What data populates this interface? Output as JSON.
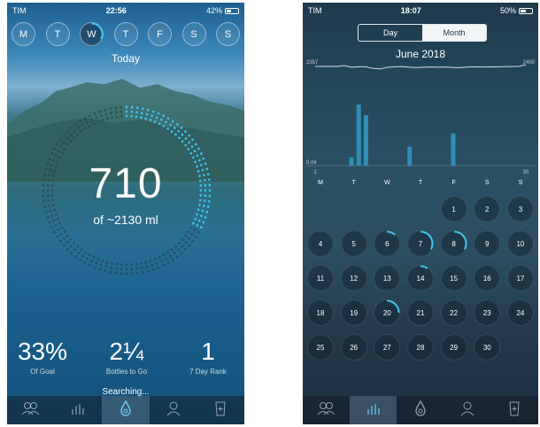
{
  "left": {
    "status": {
      "carrier": "TIM",
      "time": "22:56",
      "battery": "42%",
      "battery_level": 0.42
    },
    "weekdays": [
      {
        "label": "M",
        "active": false
      },
      {
        "label": "T",
        "active": false
      },
      {
        "label": "W",
        "active": true,
        "progress": 0.33
      },
      {
        "label": "T",
        "active": false
      },
      {
        "label": "F",
        "active": false
      },
      {
        "label": "S",
        "active": false
      },
      {
        "label": "S",
        "active": false
      }
    ],
    "today_label": "Today",
    "intake_value": "710",
    "goal_text": "of ~2130 ml",
    "ring_progress": 0.33,
    "stats": [
      {
        "value": "33%",
        "label": "Of Goal"
      },
      {
        "value": "2¼",
        "label": "Bottles to Go"
      },
      {
        "value": "1",
        "label": "7 Day Rank"
      }
    ],
    "status_message": "Searching...",
    "tabs": [
      {
        "icon": "friends-icon",
        "active": false
      },
      {
        "icon": "stats-icon",
        "active": false
      },
      {
        "icon": "drop-icon",
        "active": true
      },
      {
        "icon": "profile-icon",
        "active": false
      },
      {
        "icon": "bottle-icon",
        "active": false
      }
    ],
    "colors": {
      "accent": "#3fc4ef",
      "dots": "#2a3c4a"
    }
  },
  "right": {
    "status": {
      "carrier": "TIM",
      "time": "18:07",
      "battery": "50%",
      "battery_level": 0.5
    },
    "segments": [
      {
        "label": "Day",
        "active": false
      },
      {
        "label": "Month",
        "active": true
      }
    ],
    "month_title": "June 2018",
    "chart_labels": {
      "top_left": "2357",
      "top_right": "2400",
      "bottom_left": "0 ml",
      "x_start": "1",
      "x_end": "30"
    },
    "weekday_headers": [
      "M",
      "T",
      "W",
      "T",
      "F",
      "S",
      "S"
    ],
    "calendar": {
      "leading_blanks": 4,
      "days": [
        "1",
        "2",
        "3",
        "4",
        "5",
        "6",
        "7",
        "8",
        "9",
        "10",
        "11",
        "12",
        "13",
        "14",
        "15",
        "16",
        "17",
        "18",
        "19",
        "20",
        "21",
        "22",
        "23",
        "24",
        "25",
        "26",
        "27",
        "28",
        "29",
        "30"
      ],
      "progress": {
        "6": 0.12,
        "7": 0.33,
        "8": 0.33,
        "14": 0.1,
        "20": 0.25
      }
    },
    "chart_data": {
      "type": "bar",
      "x": [
        1,
        2,
        3,
        4,
        5,
        6,
        7,
        8,
        9,
        10,
        11,
        12,
        13,
        14,
        15,
        16,
        17,
        18,
        19,
        20,
        21,
        22,
        23,
        24,
        25,
        26,
        27,
        28,
        29,
        30
      ],
      "values": [
        0,
        0,
        0,
        0,
        0,
        0,
        0,
        0,
        0,
        0,
        0,
        0,
        0,
        0,
        0,
        0,
        0,
        0,
        0,
        0,
        0,
        0,
        0,
        0,
        0,
        0,
        0,
        0,
        0,
        0
      ],
      "bars": [
        {
          "x": 6,
          "value": 200
        },
        {
          "x": 7,
          "value": 1450
        },
        {
          "x": 8,
          "value": 1200
        },
        {
          "x": 14,
          "value": 450
        },
        {
          "x": 20,
          "value": 770
        }
      ],
      "goal_line": [
        2357,
        2357,
        2357,
        2357,
        2380,
        2340,
        2350,
        2350,
        2310,
        2300,
        2340,
        2350,
        2355,
        2340,
        2330,
        2340,
        2345,
        2340,
        2345,
        2330,
        2330,
        2345,
        2350,
        2345,
        2350,
        2348,
        2352,
        2355,
        2358,
        2400
      ],
      "ylim": [
        0,
        2400
      ],
      "ylabel_top_left": "2357",
      "ylabel_top_right": "2400",
      "ylabel_bottom": "0 ml",
      "x_ticks": [
        "1",
        "30"
      ]
    },
    "tabs": [
      {
        "icon": "friends-icon",
        "active": false
      },
      {
        "icon": "stats-icon",
        "active": true
      },
      {
        "icon": "drop-icon",
        "active": false
      },
      {
        "icon": "profile-icon",
        "active": false
      },
      {
        "icon": "bottle-icon",
        "active": false
      }
    ],
    "colors": {
      "accent": "#3fc4ef",
      "bar": "#2e8fb8"
    }
  }
}
